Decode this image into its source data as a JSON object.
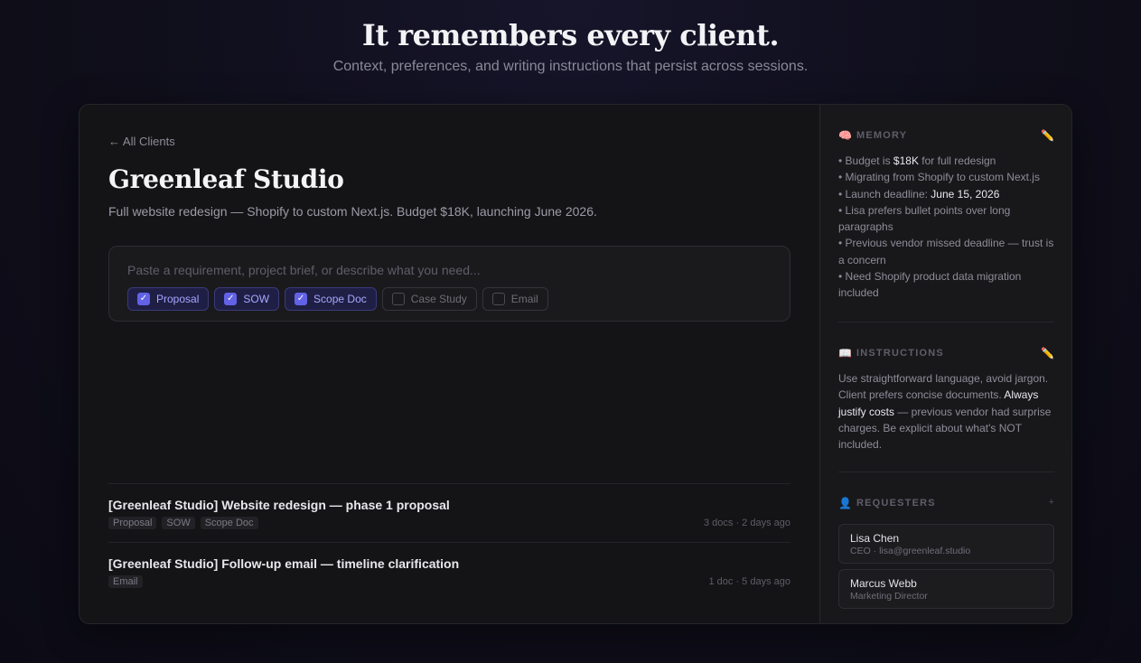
{
  "hero": {
    "title": "It remembers every client.",
    "subtitle": "Context, preferences, and writing instructions that persist across sessions."
  },
  "client": {
    "back_label": "← All Clients",
    "name": "Greenleaf Studio",
    "description": "Full website redesign — Shopify to custom Next.js. Budget $18K, launching June 2026."
  },
  "composer": {
    "placeholder": "Paste a requirement, project brief, or describe what you need...",
    "doc_types": [
      {
        "label": "Proposal",
        "checked": true
      },
      {
        "label": "SOW",
        "checked": true
      },
      {
        "label": "Scope Doc",
        "checked": true
      },
      {
        "label": "Case Study",
        "checked": false
      },
      {
        "label": "Email",
        "checked": false
      }
    ]
  },
  "history": [
    {
      "title": "[Greenleaf Studio] Website redesign — phase 1 proposal",
      "tags": [
        "Proposal",
        "SOW",
        "Scope Doc"
      ],
      "meta": "3 docs · 2 days ago"
    },
    {
      "title": "[Greenleaf Studio] Follow-up email — timeline clarification",
      "tags": [
        "Email"
      ],
      "meta": "1 doc · 5 days ago"
    }
  ],
  "memory": {
    "icon": "brain-icon",
    "label": "MEMORY",
    "edit_icon": "pencil-icon",
    "items": [
      {
        "pre": "Budget is ",
        "em": "$18K",
        "post": " for full redesign"
      },
      {
        "pre": "Migrating from Shopify to custom Next.js",
        "em": "",
        "post": ""
      },
      {
        "pre": "Launch deadline: ",
        "em": "June 15, 2026",
        "post": ""
      },
      {
        "pre": "Lisa prefers bullet points over long paragraphs",
        "em": "",
        "post": ""
      },
      {
        "pre": "Previous vendor missed deadline — trust is a concern",
        "em": "",
        "post": ""
      },
      {
        "pre": "Need Shopify product data migration included",
        "em": "",
        "post": ""
      }
    ]
  },
  "instructions": {
    "icon": "book-icon",
    "label": "INSTRUCTIONS",
    "edit_icon": "pencil-icon",
    "text_before": "Use straightforward language, avoid jargon. Client prefers concise documents. ",
    "text_em": "Always justify costs",
    "text_after": " — previous vendor had surprise charges. Be explicit about what's NOT included."
  },
  "requesters": {
    "icon": "person-icon",
    "label": "REQUESTERS",
    "add_label": "+",
    "people": [
      {
        "name": "Lisa Chen",
        "role": "CEO · lisa@greenleaf.studio"
      },
      {
        "name": "Marcus Webb",
        "role": "Marketing Director"
      }
    ]
  },
  "colors": {
    "accent": "#6262e6",
    "chip_selected_text": "#a9a6ff",
    "background": "#0f0e1a",
    "card": "#141416"
  }
}
